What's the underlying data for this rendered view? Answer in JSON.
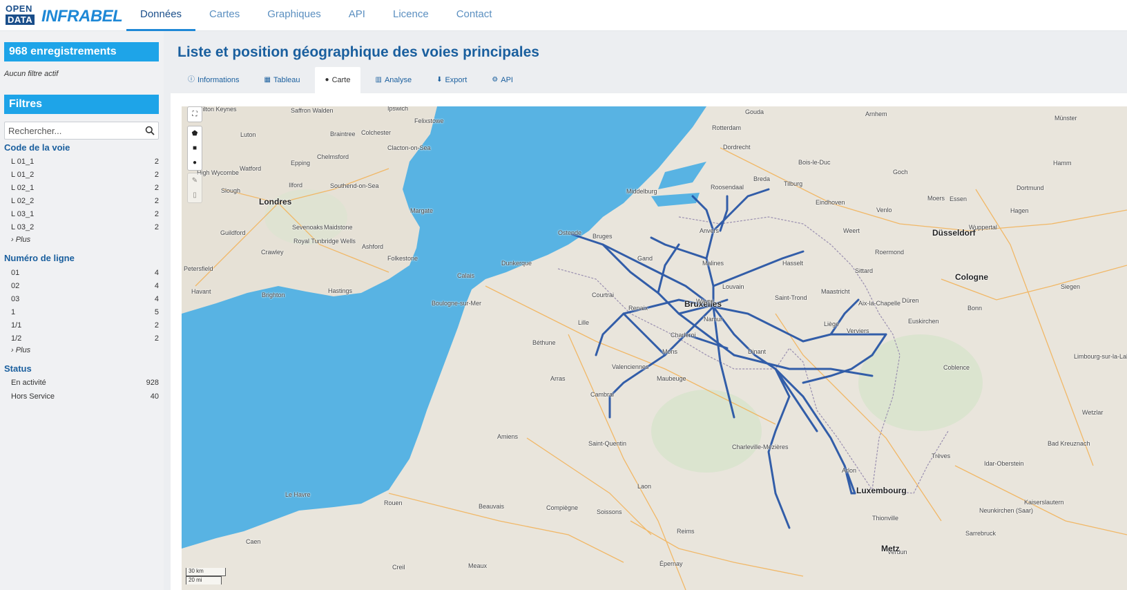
{
  "logo": {
    "line1": "OPEN",
    "line2": "DATA",
    "brand": "INFRABEL"
  },
  "nav": {
    "items": [
      "Données",
      "Cartes",
      "Graphiques",
      "API",
      "Licence",
      "Contact"
    ],
    "active_index": 0
  },
  "sidebar": {
    "records": "968 enregistrements",
    "no_filter": "Aucun filtre actif",
    "filters_title": "Filtres",
    "search_placeholder": "Rechercher...",
    "groups": [
      {
        "title": "Code de la voie",
        "items": [
          {
            "label": "L 01_1",
            "count": "2"
          },
          {
            "label": "L 01_2",
            "count": "2"
          },
          {
            "label": "L 02_1",
            "count": "2"
          },
          {
            "label": "L 02_2",
            "count": "2"
          },
          {
            "label": "L 03_1",
            "count": "2"
          },
          {
            "label": "L 03_2",
            "count": "2"
          }
        ],
        "more": "› Plus"
      },
      {
        "title": "Numéro de ligne",
        "items": [
          {
            "label": "01",
            "count": "4"
          },
          {
            "label": "02",
            "count": "4"
          },
          {
            "label": "03",
            "count": "4"
          },
          {
            "label": "1",
            "count": "5"
          },
          {
            "label": "1/1",
            "count": "2"
          },
          {
            "label": "1/2",
            "count": "2"
          }
        ],
        "more": "› Plus"
      },
      {
        "title": "Status",
        "items": [
          {
            "label": "En activité",
            "count": "928"
          },
          {
            "label": "Hors Service",
            "count": "40"
          }
        ]
      }
    ]
  },
  "main": {
    "title": "Liste et position géographique des voies principales",
    "tabs": [
      {
        "label": "Informations",
        "icon": "info-circle-icon"
      },
      {
        "label": "Tableau",
        "icon": "table-icon"
      },
      {
        "label": "Carte",
        "icon": "globe-icon"
      },
      {
        "label": "Analyse",
        "icon": "bar-chart-icon"
      },
      {
        "label": "Export",
        "icon": "download-icon"
      },
      {
        "label": "API",
        "icon": "cogs-icon"
      }
    ],
    "active_tab": 2
  },
  "map": {
    "colors": {
      "sea": "#58b3e3",
      "land": "#e9e5dc",
      "rail": "#1f4fa3",
      "road": "#f2b35a"
    },
    "cities": [
      "Milton Keynes",
      "Saffron Walden",
      "Ipswich",
      "Felixstowe",
      "Luton",
      "Braintree",
      "Colchester",
      "Clacton-on-Sea",
      "Chelmsford",
      "High Wycombe",
      "Watford",
      "Epping",
      "Southend-on-Sea",
      "Slough",
      "Ilford",
      "Londres",
      "Margate",
      "Guildford",
      "Sevenoaks",
      "Maidstone",
      "Royal Tunbridge Wells",
      "Ashford",
      "Folkestone",
      "Crawley",
      "Petersfield",
      "Havant",
      "Brighton",
      "Hastings",
      "Calais",
      "Dunkerque",
      "Ostende",
      "Bruges",
      "Boulogne-sur-Mer",
      "Béthune",
      "Lille",
      "Courtrai",
      "Renaix",
      "Bruxelles",
      "Gand",
      "Anvers",
      "Malines",
      "Louvain",
      "Saint-Trond",
      "Hasselt",
      "Maastricht",
      "Aix-la-Chapelle",
      "Liège",
      "Verviers",
      "Namur",
      "Charleroi",
      "Mons",
      "Wavre",
      "Dinant",
      "Valenciennes",
      "Maubeuge",
      "Arras",
      "Cambrai",
      "Amiens",
      "Saint-Quentin",
      "Le Havre",
      "Rouen",
      "Caen",
      "Beauvais",
      "Compiègne",
      "Soissons",
      "Laon",
      "Reims",
      "Verdun",
      "Charleville-Mézières",
      "Arlon",
      "Luxembourg",
      "Metz",
      "Thionville",
      "Trèves",
      "Rotterdam",
      "Dordrecht",
      "Breda",
      "Tilburg",
      "Eindhoven",
      "Middelburg",
      "Roosendaal",
      "Bois-le-Duc",
      "Gouda",
      "Arnhem",
      "Düsseldorf",
      "Cologne",
      "Bonn",
      "Coblence",
      "Dortmund",
      "Hamm",
      "Münster",
      "Hagen",
      "Wuppertal",
      "Venlo",
      "Moers",
      "Essen",
      "Goch",
      "Weert",
      "Roermond",
      "Sittard",
      "Düren",
      "Euskirchen",
      "Siegen",
      "Kaiserslautern",
      "Sarrebruck",
      "Neunkirchen (Saar)",
      "Idar-Oberstein",
      "Bad Kreuznach",
      "Limbourg-sur-la-Lahn",
      "Wetzlar",
      "Épernay",
      "Creil",
      "Meaux"
    ],
    "scale": [
      "30 km",
      "20 mi"
    ]
  }
}
